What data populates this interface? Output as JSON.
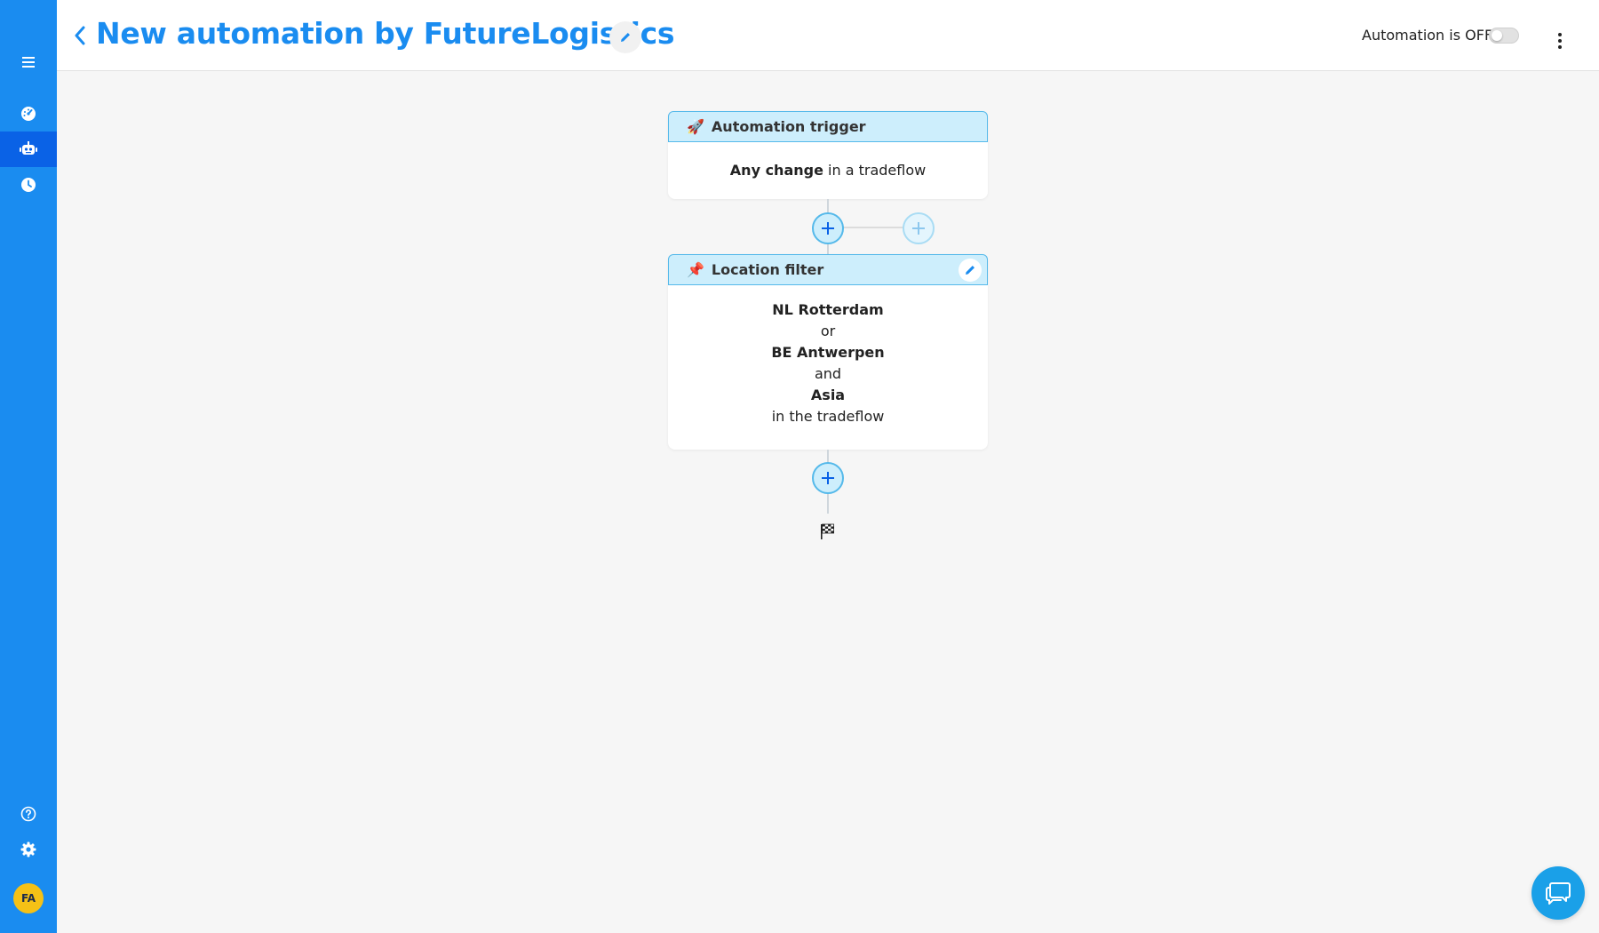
{
  "header": {
    "title": "New automation by FutureLogistics",
    "automation_status_label": "Automation is OFF"
  },
  "automation_toggle": {
    "enabled": false
  },
  "sidebar": {
    "items": [
      {
        "name": "menu",
        "icon": "hamburger-menu-icon",
        "active": false
      },
      {
        "name": "dashboard",
        "icon": "speedometer-icon",
        "active": false
      },
      {
        "name": "automations",
        "icon": "robot-icon",
        "active": true
      },
      {
        "name": "history",
        "icon": "clock-icon",
        "active": false
      },
      {
        "name": "help",
        "icon": "help-circle-icon",
        "active": false
      },
      {
        "name": "settings",
        "icon": "gear-icon",
        "active": false
      }
    ],
    "avatar_initials": "FA"
  },
  "flow": {
    "trigger": {
      "title": "Automation trigger",
      "emoji": "🚀",
      "body_bold": "Any change",
      "body_rest": " in a tradeflow"
    },
    "filter": {
      "title": "Location filter",
      "emoji": "📌",
      "lines": [
        {
          "text": "NL Rotterdam",
          "bold": true
        },
        {
          "text": "or",
          "bold": false
        },
        {
          "text": "BE Antwerpen",
          "bold": true
        },
        {
          "text": "and",
          "bold": false
        },
        {
          "text": "Asia",
          "bold": true
        },
        {
          "text": "in the tradeflow",
          "bold": false
        }
      ]
    }
  },
  "colors": {
    "brand": "#1a8cf0",
    "sidebar_active": "#0a62e6",
    "node_header_bg": "#cdeefc",
    "node_border": "#55b9ea",
    "avatar": "#f5c116",
    "chat": "#1aa0e8"
  }
}
